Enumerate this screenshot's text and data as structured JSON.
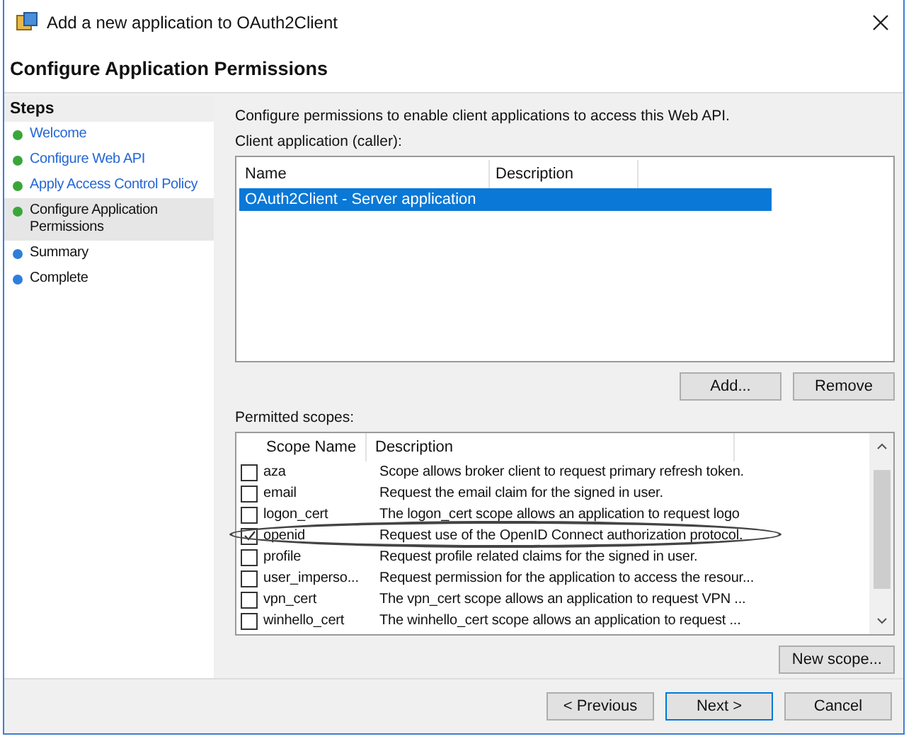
{
  "window": {
    "title": "Add a new application to OAuth2Client"
  },
  "page_title": "Configure Application Permissions",
  "steps": {
    "heading": "Steps",
    "items": [
      {
        "label": "Welcome",
        "kind": "link",
        "color": "#3aa63a",
        "selected": false
      },
      {
        "label": "Configure Web API",
        "kind": "link",
        "color": "#3aa63a",
        "selected": false
      },
      {
        "label": "Apply Access Control Policy",
        "kind": "link",
        "color": "#3aa63a",
        "selected": false
      },
      {
        "label": "Configure Application Permissions",
        "kind": "text",
        "color": "#3aa63a",
        "selected": true
      },
      {
        "label": "Summary",
        "kind": "text",
        "color": "#2f7fd8",
        "selected": false
      },
      {
        "label": "Complete",
        "kind": "text",
        "color": "#2f7fd8",
        "selected": false
      }
    ]
  },
  "intro": "Configure permissions to enable client applications to access this Web API.",
  "client_label": "Client application (caller):",
  "clients": {
    "columns": [
      "Name",
      "Description"
    ],
    "rows": [
      {
        "name": "OAuth2Client - Server application",
        "description": "",
        "selected": true
      }
    ]
  },
  "client_buttons": [
    "Add...",
    "Remove"
  ],
  "scopes_label": "Permitted scopes:",
  "scopes": {
    "columns": [
      "Scope Name",
      "Description"
    ],
    "rows": [
      {
        "name": "aza",
        "description": "Scope allows broker client to request primary refresh token.",
        "checked": false,
        "highlighted": false
      },
      {
        "name": "email",
        "description": "Request the email claim for the signed in user.",
        "checked": false,
        "highlighted": false
      },
      {
        "name": "logon_cert",
        "description": "The logon_cert scope allows an application to request logo",
        "checked": false,
        "highlighted": false
      },
      {
        "name": "openid",
        "description": "Request use of the OpenID Connect authorization protocol.",
        "checked": true,
        "highlighted": true
      },
      {
        "name": "profile",
        "description": "Request profile related claims for the signed in user.",
        "checked": false,
        "highlighted": false
      },
      {
        "name": "user_imperso...",
        "description": "Request permission for the application to access the resour...",
        "checked": false,
        "highlighted": false
      },
      {
        "name": "vpn_cert",
        "description": "The vpn_cert scope allows an application to request VPN ...",
        "checked": false,
        "highlighted": false
      },
      {
        "name": "winhello_cert",
        "description": "The winhello_cert scope allows an application to request ...",
        "checked": false,
        "highlighted": false
      }
    ]
  },
  "scope_button": "New scope...",
  "footer_buttons": [
    {
      "label": "< Previous",
      "default": false
    },
    {
      "label": "Next >",
      "default": true
    },
    {
      "label": "Cancel",
      "default": false
    }
  ]
}
